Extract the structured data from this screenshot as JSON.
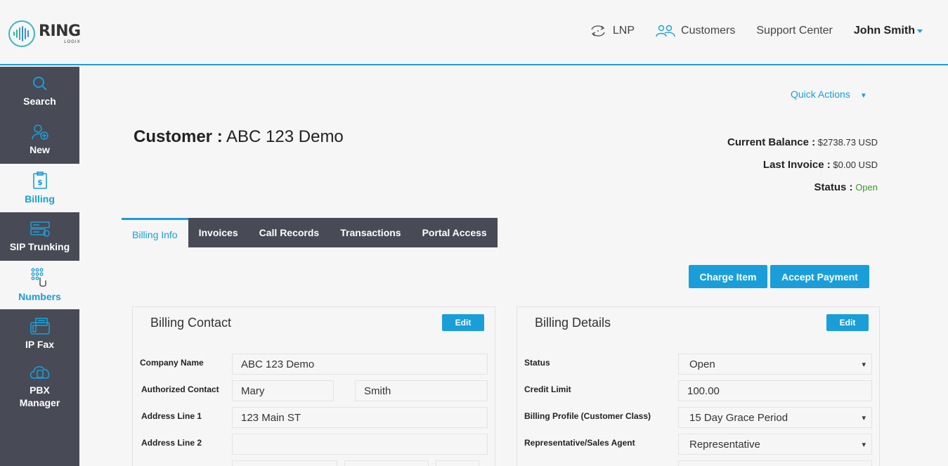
{
  "brand": {
    "name": "RING",
    "sub": "LOGIX"
  },
  "topnav": {
    "lnp": "LNP",
    "customers": "Customers",
    "support": "Support Center",
    "user": "John Smith"
  },
  "sidebar": {
    "items": [
      {
        "label": "Search"
      },
      {
        "label": "New"
      },
      {
        "label": "Billing"
      },
      {
        "label": "SIP Trunking"
      },
      {
        "label": "Numbers"
      },
      {
        "label": "IP Fax"
      },
      {
        "label": "PBX",
        "label2": "Manager"
      }
    ]
  },
  "quick_actions": "Quick Actions",
  "customer": {
    "label": "Customer :",
    "name": "ABC 123 Demo"
  },
  "summary": {
    "balance_label": "Current Balance :",
    "balance": "$2738.73 USD",
    "invoice_label": "Last Invoice :",
    "invoice": "$0.00 USD",
    "status_label": "Status :",
    "status": "Open"
  },
  "tabs": [
    "Billing Info",
    "Invoices",
    "Call Records",
    "Transactions",
    "Portal Access"
  ],
  "actions": {
    "charge": "Charge Item",
    "payment": "Accept Payment"
  },
  "contact": {
    "title": "Billing Contact",
    "edit": "Edit",
    "company_label": "Company Name",
    "company": "ABC 123 Demo",
    "auth_label": "Authorized Contact",
    "first": "Mary",
    "last": "Smith",
    "addr1_label": "Address Line 1",
    "addr1": "123 Main ST",
    "addr2_label": "Address Line 2",
    "addr2": ""
  },
  "details": {
    "title": "Billing Details",
    "edit": "Edit",
    "status_label": "Status",
    "status": "Open",
    "credit_label": "Credit Limit",
    "credit": "100.00",
    "profile_label": "Billing Profile (Customer Class)",
    "profile": "15 Day Grace Period",
    "rep_label": "Representative/Sales Agent",
    "rep": "Representative"
  },
  "colors": {
    "accent": "#1a9ed9",
    "sidebar": "#484a55",
    "status_open": "#3a9a2b"
  }
}
